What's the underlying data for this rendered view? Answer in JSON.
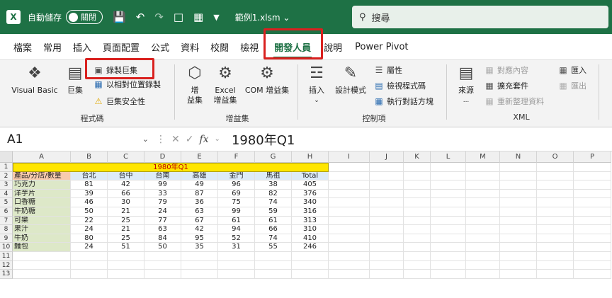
{
  "titlebar": {
    "app_icon": "excel-icon",
    "autosave_label": "自動儲存",
    "autosave_state": "關閉",
    "filename": "範例1.xlsm",
    "search_placeholder": "搜尋"
  },
  "menu": {
    "tabs": [
      "檔案",
      "常用",
      "插入",
      "頁面配置",
      "公式",
      "資料",
      "校閱",
      "檢視",
      "開發人員",
      "說明",
      "Power Pivot"
    ],
    "active": "開發人員"
  },
  "ribbon": {
    "code_group": {
      "label": "程式碼",
      "visual_basic": "Visual Basic",
      "macros": "巨集",
      "record_macro": "錄製巨集",
      "relative_ref": "以相對位置錄製",
      "macro_security": "巨集安全性"
    },
    "addins_group": {
      "label": "增益集",
      "addins_l1": "增",
      "addins_l2": "益集",
      "excel_addins_l1": "Excel",
      "excel_addins_l2": "增益集",
      "com_addins": "COM 增益集"
    },
    "controls_group": {
      "label": "控制項",
      "insert": "插入",
      "design_mode": "設計模式",
      "properties": "屬性",
      "view_code": "檢視程式碼",
      "run_dialog": "執行對話方塊"
    },
    "xml_group": {
      "label": "XML",
      "source": "來源",
      "map_properties": "對應內容",
      "expansion_packs": "擴充套件",
      "refresh_data": "重新整理資料",
      "import": "匯入",
      "export": "匯出"
    }
  },
  "formula_bar": {
    "name_box": "A1",
    "fx": "fx",
    "value": "1980年Q1"
  },
  "sheet": {
    "columns": [
      "A",
      "B",
      "C",
      "D",
      "E",
      "F",
      "G",
      "H",
      "I",
      "J",
      "K",
      "L",
      "M",
      "N",
      "O",
      "P"
    ],
    "rows": [
      "1",
      "2",
      "3",
      "4",
      "5",
      "6",
      "7",
      "8",
      "9",
      "10",
      "11",
      "12",
      "13"
    ],
    "title": "1980年Q1",
    "header": [
      "產品/分店/數量",
      "台北",
      "台中",
      "台南",
      "高雄",
      "金門",
      "馬祖",
      "Total"
    ],
    "data": [
      [
        "巧克力",
        "81",
        "42",
        "99",
        "49",
        "96",
        "38",
        "405"
      ],
      [
        "洋芋片",
        "39",
        "66",
        "33",
        "87",
        "69",
        "82",
        "376"
      ],
      [
        "口香糖",
        "46",
        "30",
        "79",
        "36",
        "75",
        "74",
        "340"
      ],
      [
        "牛奶糖",
        "50",
        "21",
        "24",
        "63",
        "99",
        "59",
        "316"
      ],
      [
        "可樂",
        "22",
        "25",
        "77",
        "67",
        "61",
        "61",
        "313"
      ],
      [
        "果汁",
        "24",
        "21",
        "63",
        "42",
        "94",
        "66",
        "310"
      ],
      [
        "牛奶",
        "80",
        "25",
        "84",
        "95",
        "52",
        "74",
        "410"
      ],
      [
        "麵包",
        "24",
        "51",
        "50",
        "35",
        "31",
        "55",
        "246"
      ]
    ]
  }
}
